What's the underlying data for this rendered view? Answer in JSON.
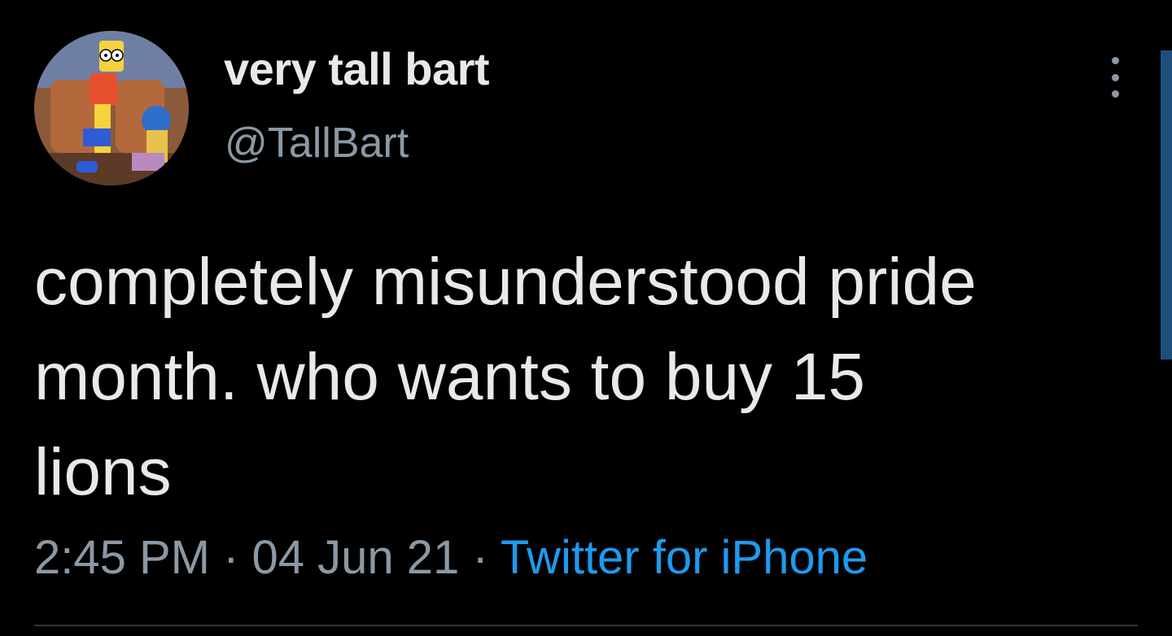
{
  "tweet": {
    "display_name": "very tall bart",
    "handle": "@TallBart",
    "text_lines": [
      "completely misunderstood pride",
      "month. who wants to buy 15",
      "lions"
    ],
    "time": "2:45 PM",
    "separator": " · ",
    "date": "04 Jun 21",
    "source": "Twitter for iPhone"
  },
  "icons": {
    "more": "more-vertical-icon",
    "avatar": "avatar-image"
  },
  "colors": {
    "background": "#000000",
    "primary_text": "#e7e9ea",
    "secondary_text": "#8b98a5",
    "link": "#1d9bf0"
  }
}
